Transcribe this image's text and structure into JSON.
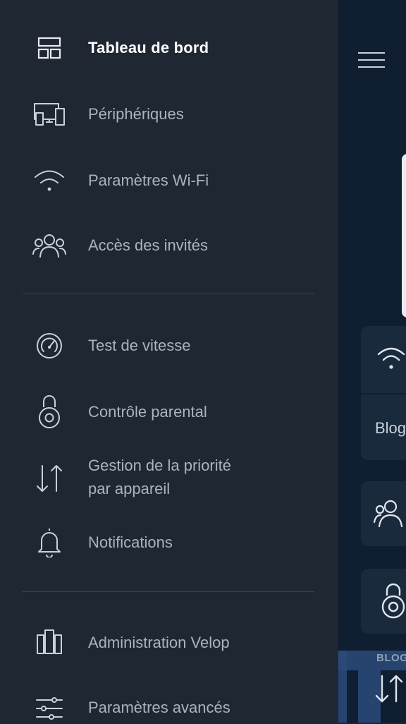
{
  "drawer": {
    "items": [
      {
        "id": "dashboard",
        "label": "Tableau de bord",
        "icon": "dashboard-icon",
        "active": true
      },
      {
        "id": "devices",
        "label": "Périphériques",
        "icon": "devices-icon",
        "active": false
      },
      {
        "id": "wifi",
        "label": "Paramètres Wi-Fi",
        "icon": "wifi-icon",
        "active": false
      },
      {
        "id": "guest",
        "label": "Accès des invités",
        "icon": "guests-icon",
        "active": false
      },
      {
        "id": "speed",
        "label": "Test de vitesse",
        "icon": "speedometer-icon",
        "active": false
      },
      {
        "id": "parental",
        "label": "Contrôle parental",
        "icon": "lock-icon",
        "active": false
      },
      {
        "id": "priority",
        "label_line1": "Gestion de la priorité",
        "label_line2": "par appareil",
        "icon": "up-down-arrows-icon",
        "active": false
      },
      {
        "id": "notifications",
        "label": "Notifications",
        "icon": "bell-icon",
        "active": false
      },
      {
        "id": "admin",
        "label": "Administration Velop",
        "icon": "velop-nodes-icon",
        "active": false
      },
      {
        "id": "advanced",
        "label": "Paramètres avancés",
        "icon": "sliders-icon",
        "active": false
      }
    ]
  },
  "background": {
    "menu_icon": "hamburger-icon",
    "wifi_card_text": "Blog"
  },
  "watermark": {
    "text": "BLOG"
  },
  "colors": {
    "drawer_bg": "#1f2733",
    "app_bg": "#0f1e30",
    "label": "#aab3bf",
    "active_label": "#ffffff",
    "icon_stroke": "#c9d1db",
    "divider": "#394453"
  }
}
